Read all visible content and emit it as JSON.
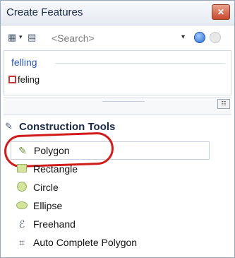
{
  "window": {
    "title": "Create Features",
    "close_icon": "close-icon"
  },
  "toolbar": {
    "organize_icon": "organize-templates-icon",
    "manage_icon": "manage-templates-icon",
    "search_placeholder": "<Search>",
    "search_icon": "search-icon",
    "clear_icon": "clear-search-icon"
  },
  "templates": {
    "group_label": "felling",
    "items": [
      {
        "label": "feling",
        "swatch_color": "#c43a3a"
      }
    ]
  },
  "construction": {
    "title": "Construction Tools",
    "tools": [
      {
        "label": "Polygon",
        "icon": "polygon-icon",
        "selected": true
      },
      {
        "label": "Rectangle",
        "icon": "rectangle-icon",
        "selected": false
      },
      {
        "label": "Circle",
        "icon": "circle-icon",
        "selected": false
      },
      {
        "label": "Ellipse",
        "icon": "ellipse-icon",
        "selected": false
      },
      {
        "label": "Freehand",
        "icon": "freehand-icon",
        "selected": false
      },
      {
        "label": "Auto Complete Polygon",
        "icon": "auto-complete-polygon-icon",
        "selected": false
      }
    ]
  },
  "colors": {
    "highlight_ring": "#d11c1c",
    "group_text": "#2a58b8"
  }
}
